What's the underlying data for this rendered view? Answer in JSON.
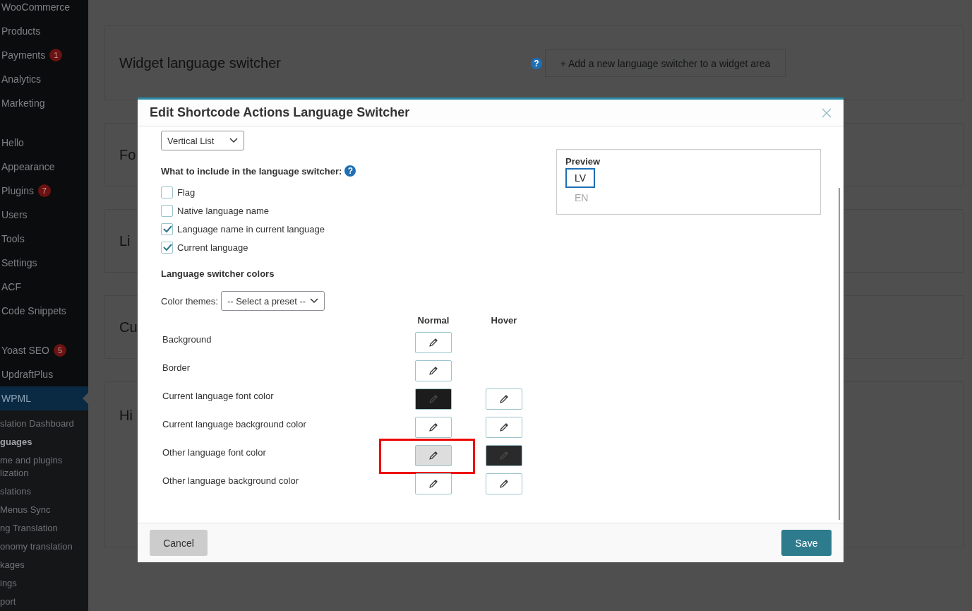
{
  "sidebar": {
    "groups": [
      {
        "items": [
          {
            "label": "WooCommerce",
            "selected": false
          },
          {
            "label": "Products",
            "selected": false
          },
          {
            "label": "Payments",
            "badge": "1",
            "selected": false
          },
          {
            "label": "Analytics",
            "selected": false
          },
          {
            "label": "Marketing",
            "selected": false
          }
        ]
      },
      {
        "items": [
          {
            "label": "Hello",
            "selected": false
          },
          {
            "label": "Appearance",
            "selected": false
          },
          {
            "label": "Plugins",
            "badge": "7",
            "selected": false
          },
          {
            "label": "Users",
            "selected": false
          },
          {
            "label": "Tools",
            "selected": false
          },
          {
            "label": "Settings",
            "selected": false
          },
          {
            "label": "ACF",
            "selected": false
          },
          {
            "label": "Code Snippets",
            "selected": false
          }
        ]
      },
      {
        "items": [
          {
            "label": "Yoast SEO",
            "badge": "5",
            "selected": false
          },
          {
            "label": "UpdraftPlus",
            "selected": false
          },
          {
            "label": "WPML",
            "selected": true
          }
        ]
      }
    ],
    "submenu": [
      {
        "label": "slation Dashboard",
        "current": false
      },
      {
        "label": "guages",
        "current": true
      },
      {
        "label": "me and plugins lization",
        "current": false
      },
      {
        "label": "slations",
        "current": false
      },
      {
        "label": "Menus Sync",
        "current": false
      },
      {
        "label": "ng Translation",
        "current": false
      },
      {
        "label": "onomy translation",
        "current": false
      },
      {
        "label": "kages",
        "current": false
      },
      {
        "label": "ings",
        "current": false
      },
      {
        "label": "port",
        "current": false
      }
    ]
  },
  "page": {
    "cards": [
      {
        "kind": "widget",
        "title": "Widget language switcher",
        "help": "?",
        "button": "+ Add a new language switcher to a widget area"
      },
      {
        "kind": "plain",
        "title": "Fo"
      },
      {
        "kind": "plain",
        "title": "Li"
      },
      {
        "kind": "plain",
        "title": "Cu"
      },
      {
        "kind": "action",
        "title": "Hi"
      }
    ]
  },
  "dialog": {
    "title": "Edit Shortcode Actions Language Switcher",
    "style_select": "Vertical List",
    "include_heading": "What to include in the language switcher:",
    "include_help": "?",
    "include_options": [
      {
        "label": "Flag",
        "checked": false
      },
      {
        "label": "Native language name",
        "checked": false
      },
      {
        "label": "Language name in current language",
        "checked": true
      },
      {
        "label": "Current language",
        "checked": true
      }
    ],
    "colors_heading": "Language switcher colors",
    "themes_label": "Color themes:",
    "themes_select": "-- Select a preset --",
    "columns": [
      "Normal",
      "Hover"
    ],
    "color_rows": [
      {
        "label": "Background",
        "normal": {
          "color": "#ffffff",
          "highlighted": false
        }
      },
      {
        "label": "Border",
        "normal": {
          "color": "#ffffff",
          "highlighted": false
        }
      },
      {
        "label": "Current language font color",
        "normal": {
          "color": "#1c1c1c",
          "highlighted": false
        },
        "hover": {
          "color": "#ffffff",
          "highlighted": false
        }
      },
      {
        "label": "Current language background color",
        "normal": {
          "color": "#ffffff",
          "highlighted": false
        },
        "hover": {
          "color": "#ffffff",
          "highlighted": false
        }
      },
      {
        "label": "Other language font color",
        "normal": {
          "color": "#dddddd",
          "highlighted": true
        },
        "hover": {
          "color": "#2a2a2a",
          "highlighted": false
        }
      },
      {
        "label": "Other language background color",
        "normal": {
          "color": "#ffffff",
          "highlighted": false
        },
        "hover": {
          "color": "#ffffff",
          "highlighted": false
        }
      }
    ],
    "preview": {
      "title": "Preview",
      "items": [
        {
          "label": "LV",
          "current": true
        },
        {
          "label": "EN",
          "current": false
        }
      ]
    },
    "cancel": "Cancel",
    "save": "Save"
  }
}
